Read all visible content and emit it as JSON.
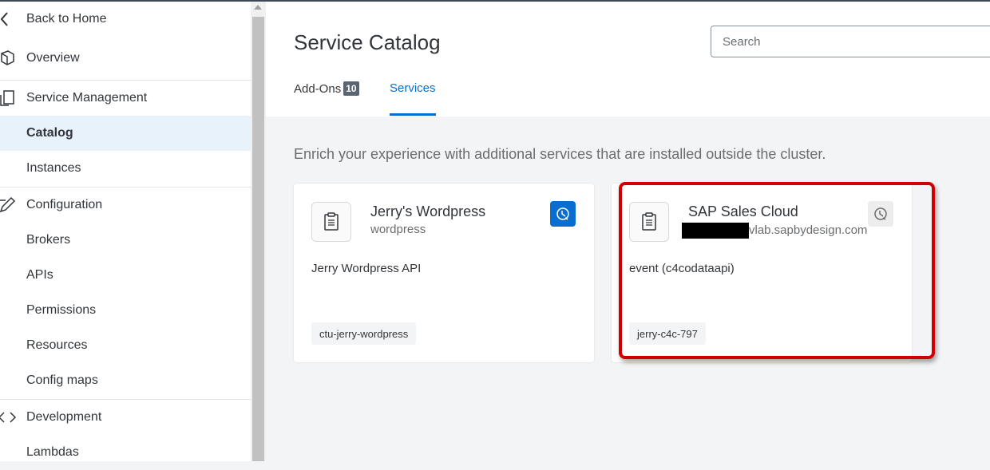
{
  "sidebar": {
    "items": [
      {
        "label": "Back to Home",
        "icon": "chevron-left-icon"
      },
      {
        "label": "Overview",
        "icon": "overview-icon"
      },
      {
        "label": "Service Management",
        "icon": "service-management-icon"
      },
      {
        "label": "Catalog"
      },
      {
        "label": "Instances"
      },
      {
        "label": "Configuration",
        "icon": "edit-icon"
      },
      {
        "label": "Brokers"
      },
      {
        "label": "APIs"
      },
      {
        "label": "Permissions"
      },
      {
        "label": "Resources"
      },
      {
        "label": "Config maps"
      },
      {
        "label": "Development",
        "icon": "code-icon"
      },
      {
        "label": "Lambdas"
      }
    ]
  },
  "header": {
    "title": "Service Catalog",
    "search_placeholder": "Search",
    "tabs": [
      {
        "label": "Add-Ons",
        "badge": "10"
      },
      {
        "label": "Services"
      }
    ]
  },
  "main": {
    "description": "Enrich your experience with additional services that are installed outside the cluster.",
    "cards": [
      {
        "title": "Jerry's Wordpress",
        "subtitle": "wordpress",
        "description": "Jerry Wordpress API",
        "tag": "ctu-jerry-wordpress",
        "status_icon": "provision-icon"
      },
      {
        "title": "SAP Sales Cloud",
        "subtitle": "vlab.sapbydesign.com",
        "description": "event (c4codataapi)",
        "tag": "jerry-c4c-797",
        "status_icon": "provision-icon"
      }
    ]
  },
  "colors": {
    "accent": "#0a6ed1",
    "highlight": "#d00000",
    "active_bg": "#e8f2fb"
  }
}
